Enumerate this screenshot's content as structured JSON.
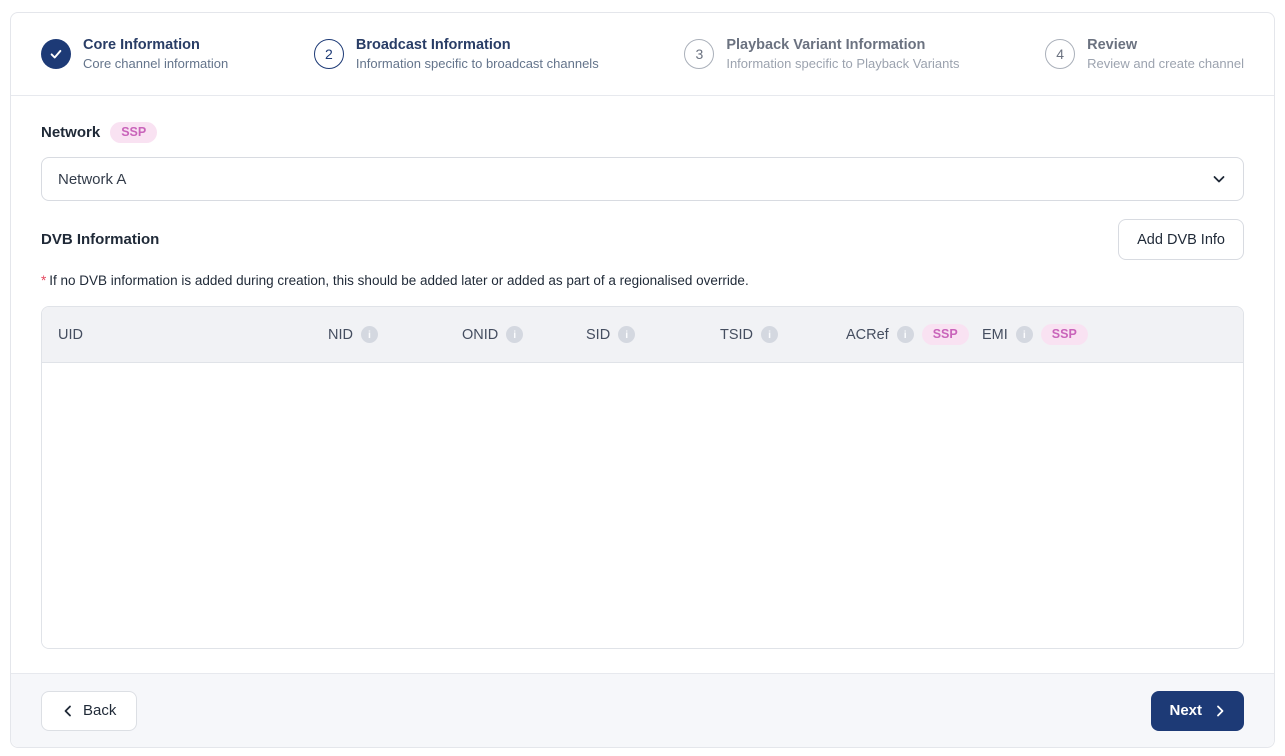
{
  "stepper": {
    "steps": [
      {
        "marker": "check",
        "title": "Core Information",
        "subtitle": "Core channel information",
        "state": "complete"
      },
      {
        "marker": "2",
        "title": "Broadcast Information",
        "subtitle": "Information specific to broadcast channels",
        "state": "active"
      },
      {
        "marker": "3",
        "title": "Playback Variant Information",
        "subtitle": "Information specific to Playback Variants",
        "state": "upcoming"
      },
      {
        "marker": "4",
        "title": "Review",
        "subtitle": "Review and create channel",
        "state": "upcoming"
      }
    ]
  },
  "network": {
    "label": "Network",
    "badge": "SSP",
    "selected_value": "Network A"
  },
  "dvb": {
    "heading": "DVB Information",
    "add_button_label": "Add DVB Info",
    "note_marker": "*",
    "note_text": "If no DVB information is added during creation, this should be added later or added as part of a regionalised override.",
    "table": {
      "columns": [
        {
          "label": "UID",
          "has_info": false,
          "badge": ""
        },
        {
          "label": "NID",
          "has_info": true,
          "badge": ""
        },
        {
          "label": "ONID",
          "has_info": true,
          "badge": ""
        },
        {
          "label": "SID",
          "has_info": true,
          "badge": ""
        },
        {
          "label": "TSID",
          "has_info": true,
          "badge": ""
        },
        {
          "label": "ACRef",
          "has_info": true,
          "badge": "SSP"
        },
        {
          "label": "EMI",
          "has_info": true,
          "badge": "SSP"
        }
      ],
      "rows": []
    }
  },
  "icons": {
    "info_glyph": "i"
  },
  "footer": {
    "back_label": "Back",
    "next_label": "Next"
  },
  "colors": {
    "accent_navy": "#1d3a76",
    "badge_pink_bg": "#f9e2f2",
    "badge_pink_text": "#c964ba",
    "required_red": "#e4485f"
  }
}
